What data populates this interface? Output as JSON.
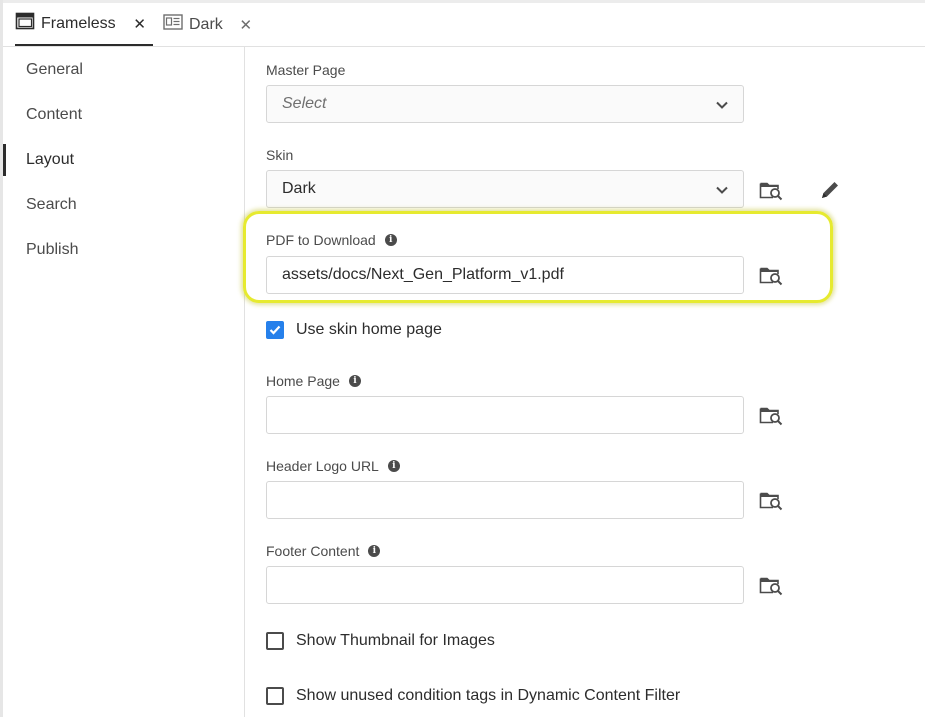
{
  "tabs": [
    {
      "label": "Frameless",
      "icon": "window-icon",
      "close": "✕"
    },
    {
      "label": "Dark",
      "icon": "skin-layout-icon",
      "close": "✕"
    }
  ],
  "sidebar": {
    "items": [
      {
        "label": "General"
      },
      {
        "label": "Content"
      },
      {
        "label": "Layout",
        "active": true
      },
      {
        "label": "Search"
      },
      {
        "label": "Publish"
      }
    ]
  },
  "form": {
    "master_page": {
      "label": "Master Page",
      "placeholder": "Select"
    },
    "skin": {
      "label": "Skin",
      "value": "Dark"
    },
    "pdf_to_download": {
      "label": "PDF to Download",
      "value": "assets/docs/Next_Gen_Platform_v1.pdf"
    },
    "use_skin_home_page": {
      "label": "Use skin home page",
      "checked": true
    },
    "home_page": {
      "label": "Home Page",
      "value": ""
    },
    "header_logo_url": {
      "label": "Header Logo URL",
      "value": ""
    },
    "footer_content": {
      "label": "Footer Content",
      "value": ""
    },
    "show_thumbnail": {
      "label": "Show Thumbnail for Images",
      "checked": false
    },
    "show_unused_tags": {
      "label": "Show unused condition tags in Dynamic Content Filter",
      "checked": false
    }
  },
  "colors": {
    "accent": "#2680eb",
    "highlight": "#e6ea2f",
    "text": "#2c2c2c",
    "border": "#d6d6d6"
  },
  "info_glyph": "i"
}
